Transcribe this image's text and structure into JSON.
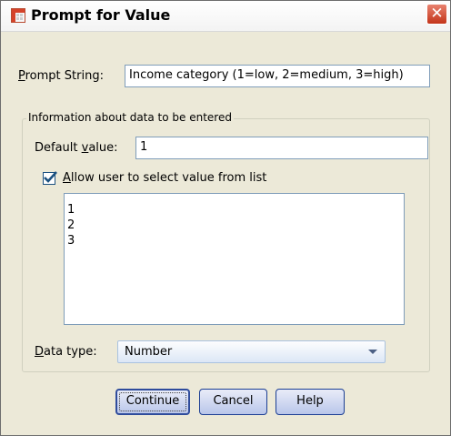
{
  "window": {
    "title": "Prompt for Value"
  },
  "prompt": {
    "label": "Prompt String:",
    "value": "Income category (1=low, 2=medium, 3=high)"
  },
  "group": {
    "legend": "Information about data to be entered",
    "default_value_label": "Default value:",
    "default_value": "1",
    "allow_list_label": "Allow user to select value from list",
    "allow_list_checked": true,
    "list_values": [
      "1",
      "2",
      "3"
    ],
    "data_type_label": "Data type:",
    "data_type_value": "Number"
  },
  "buttons": {
    "continue": "Continue",
    "cancel": "Cancel",
    "help": "Help"
  },
  "icons": {
    "app": "spreadsheet-icon",
    "close": "close-icon",
    "checkbox": "checkmark-icon",
    "dropdown": "chevron-down-icon"
  },
  "colors": {
    "close_button": "#c3341a",
    "window_bg": "#ece9d8",
    "button_border": "#1c3f94"
  }
}
